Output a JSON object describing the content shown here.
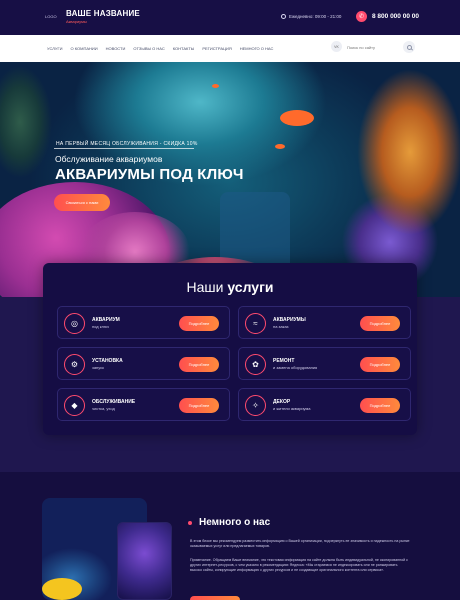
{
  "header": {
    "logo": "LOGO",
    "brand_name": "ВАШЕ НАЗВАНИЕ",
    "brand_sub": "Аквариумы",
    "hours": "Ежедневно: 09:00 - 21:00",
    "phone": "8 800 000 00 00"
  },
  "nav": {
    "items": [
      "Услуги",
      "О компании",
      "Новости",
      "Отзывы о нас",
      "Контакты",
      "Регистрация",
      "Немного о нас"
    ],
    "vk_label": "VK",
    "search_placeholder": "Поиск по сайту"
  },
  "hero": {
    "promo": "НА ПЕРВЫЙ МЕСЯЦ ОБСЛУЖИВАНИЯ - СКИДКА 10%",
    "subtitle": "Обслуживание аквариумов",
    "title": "АКВАРИУМЫ ПОД КЛЮЧ",
    "button": "Связаться с нами"
  },
  "services": {
    "title_light": "Наши",
    "title_bold": "услуги",
    "items": [
      {
        "title": "АКВАРИУМ",
        "sub": "под ключ",
        "button": "Подробнее",
        "icon": "aquarium-icon"
      },
      {
        "title": "АКВАРИУМЫ",
        "sub": "на заказ",
        "button": "Подробнее",
        "icon": "custom-aquarium-icon"
      },
      {
        "title": "УСТАНОВКА",
        "sub": "запуск",
        "button": "Подробнее",
        "icon": "installation-icon"
      },
      {
        "title": "РЕМОНТ",
        "sub": "и замена оборудования",
        "button": "Подробнее",
        "icon": "repair-icon"
      },
      {
        "title": "ОБСЛУЖИВАНИЕ",
        "sub": "чистка, уход",
        "button": "Подробнее",
        "icon": "maintenance-icon"
      },
      {
        "title": "ДЕКОР",
        "sub": "и жители аквариума",
        "button": "Подробнее",
        "icon": "decor-icon"
      }
    ]
  },
  "about": {
    "title": "Немного о нас",
    "p1": "В этом блоке мы рекомендуем разместить информацию о Вашей организации, подчеркнуть ее значимость и надежность на рынке оказываемых услуг или предлагаемых товаров.",
    "p2": "Примечание. Обращаем Ваше внимание, что текстовая информация на сайте должна быть индивидуальной, не скопированной с других интернет-ресурсов, с чем указано в рекомендациях Яндекса: «Мы стараемся не индексировать или не ранжировать высоко сайты, копирующие информацию с других ресурсов и не создающие оригинального контента или сервиса»."
  },
  "colors": {
    "accent_start": "#ff4f4f",
    "accent_end": "#ff8a3c",
    "background": "#150e3f"
  }
}
